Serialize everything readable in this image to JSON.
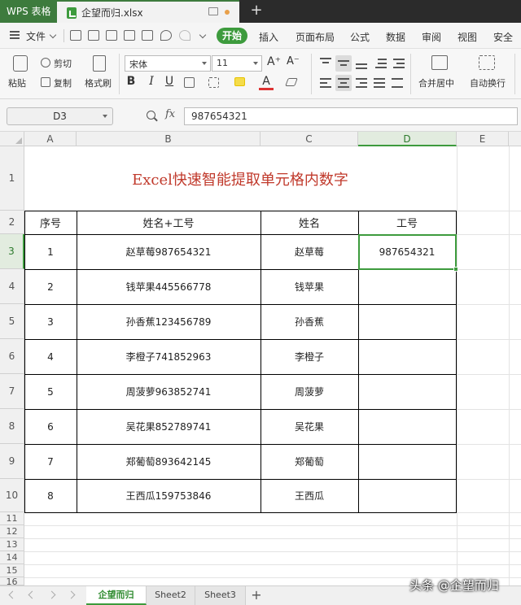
{
  "titlebar": {
    "app_tab": "WPS 表格",
    "file_name": "企望而归.xlsx",
    "new_tab": "+"
  },
  "menubar": {
    "file_label": "文件",
    "start_label": "开始",
    "items": [
      "插入",
      "页面布局",
      "公式",
      "数据",
      "审阅",
      "视图",
      "安全"
    ]
  },
  "ribbon": {
    "cut": "剪切",
    "paste": "粘贴",
    "copy": "复制",
    "format_painter": "格式刷",
    "font_name": "宋体",
    "font_size": "11",
    "merge_center": "合并居中",
    "wrap_text": "自动换行",
    "bold": "B",
    "italic": "I",
    "underline": "U",
    "font_color_letter": "A"
  },
  "formula_bar": {
    "name_box": "D3",
    "fx": "fx",
    "value": "987654321"
  },
  "grid": {
    "columns": [
      "A",
      "B",
      "C",
      "D",
      "E"
    ],
    "rows": [
      "1",
      "2",
      "3",
      "4",
      "5",
      "6",
      "7",
      "8",
      "9",
      "10",
      "11",
      "12",
      "13",
      "14",
      "15",
      "16"
    ],
    "title": "Excel快速智能提取单元格内数字",
    "headers": [
      "序号",
      "姓名+工号",
      "姓名",
      "工号"
    ],
    "data": [
      [
        "1",
        "赵草莓987654321",
        "赵草莓",
        "987654321"
      ],
      [
        "2",
        "钱苹果445566778",
        "钱苹果",
        ""
      ],
      [
        "3",
        "孙香蕉123456789",
        "孙香蕉",
        ""
      ],
      [
        "4",
        "李橙子741852963",
        "李橙子",
        ""
      ],
      [
        "5",
        "周菠萝963852741",
        "周菠萝",
        ""
      ],
      [
        "6",
        "吴花果852789741",
        "吴花果",
        ""
      ],
      [
        "7",
        "郑葡萄893642145",
        "郑葡萄",
        ""
      ],
      [
        "8",
        "王西瓜159753846",
        "王西瓜",
        ""
      ]
    ]
  },
  "sheets": {
    "tabs": [
      "企望而归",
      "Sheet2",
      "Sheet3"
    ],
    "add": "+"
  },
  "watermark": "头条 @企望而归",
  "colors": {
    "accent": "#3d9b3d",
    "title_red": "#c0392b"
  }
}
